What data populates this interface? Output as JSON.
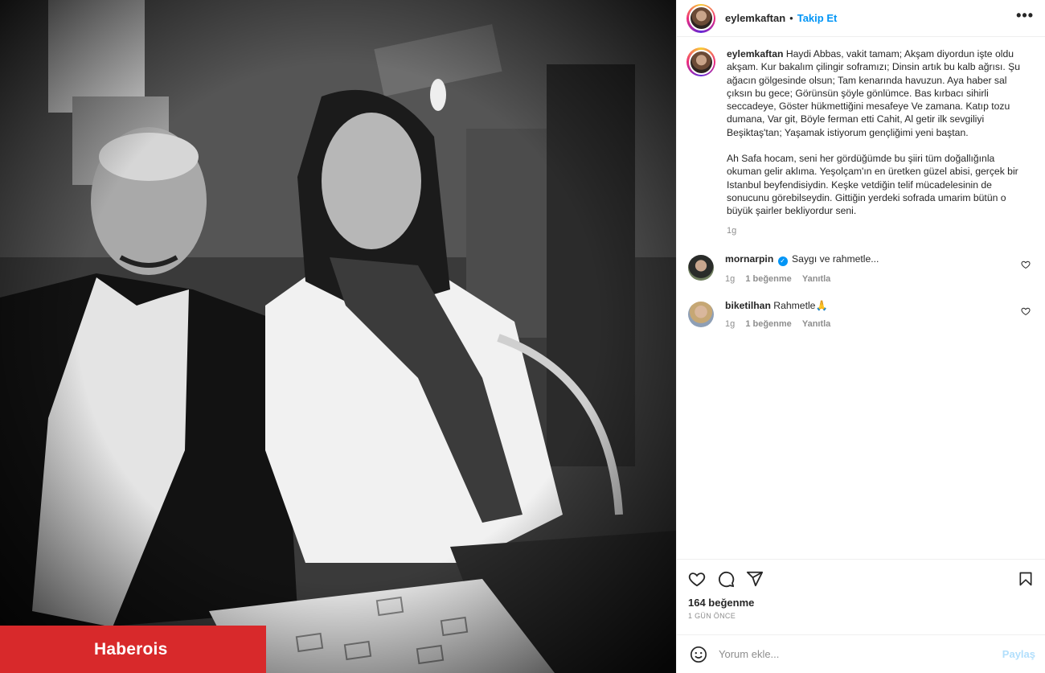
{
  "photo": {
    "description_icon": "photo",
    "watermark": "Haberois"
  },
  "post": {
    "username": "eylemkaftan",
    "separator": "•",
    "follow_label": "Takip Et",
    "more_label": "•••",
    "caption_p1": "Haydi Abbas, vakit tamam; Akşam diyordun işte oldu akşam. Kur bakalım çilingir soframızı; Dinsin artık bu kalb ağrısı. Şu ağacın gölgesinde olsun; Tam kenarında havuzun. Aya haber sal çıksın bu gece; Görünsün şöyle gönlümce. Bas kırbacı sihirli seccadeye, Göster hükmettiğini mesafeye Ve zamana. Katıp tozu dumana, Var git, Böyle ferman etti Cahit, Al getir ilk sevgiliyi Beşiktaş'tan; Yaşamak istiyorum gençliğimi yeni baştan.",
    "caption_p2": "Ah Safa hocam, seni her gördüğümde bu şiiri tüm doğallığınla okuman gelir aklıma. Yeşolçam'ın en üretken güzel abisi, gerçek bir Istanbul beyfendisiydin. Keşke vetdiğin telif mücadelesinin de sonucunu görebilseydin. Gittiğin yerdeki sofrada umarim bütün o büyük şairler bekliyordur seni.",
    "caption_time": "1g",
    "likes": "164 beğenme",
    "posted_ago": "1 GÜN ÖNCE"
  },
  "comments": [
    {
      "username": "mornarpin",
      "verified": true,
      "text": "Saygı ve rahmetle...",
      "time": "1g",
      "likes": "1 beğenme",
      "reply": "Yanıtla"
    },
    {
      "username": "biketilhan",
      "verified": false,
      "text": "Rahmetle🙏",
      "time": "1g",
      "likes": "1 beğenme",
      "reply": "Yanıtla"
    }
  ],
  "composer": {
    "placeholder": "Yorum ekle...",
    "share_label": "Paylaş"
  },
  "icons": {
    "like": "heart-icon",
    "comment": "comment-icon",
    "share": "send-icon",
    "save": "bookmark-icon",
    "emoji": "emoji-icon",
    "more": "more-icon"
  },
  "colors": {
    "link": "#0095f6",
    "watermark_bg": "#d8292b",
    "muted": "#8e8e8e"
  }
}
